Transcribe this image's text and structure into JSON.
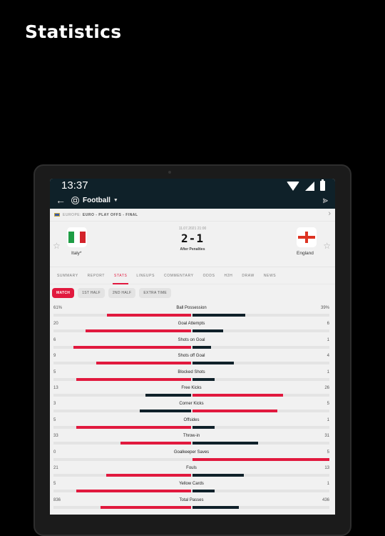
{
  "page_title": "Statistics",
  "status_bar": {
    "time": "13:37"
  },
  "app_bar": {
    "sport": "Football",
    "back_icon": "arrow-left-icon",
    "share_icon": "share-icon"
  },
  "league": {
    "region": "EUROPE:",
    "competition": "EURO - PLAY OFFS - FINAL"
  },
  "match": {
    "datetime": "11.07.2021 21:00",
    "score": "2-1",
    "note": "After Penalties",
    "home": {
      "name": "Italy*",
      "flag_colors": [
        "#1f9d45",
        "#ffffff",
        "#d3222a"
      ]
    },
    "away": {
      "name": "England"
    }
  },
  "tabs": [
    {
      "label": "SUMMARY",
      "active": false
    },
    {
      "label": "REPORT",
      "active": false
    },
    {
      "label": "STATS",
      "active": true
    },
    {
      "label": "LINEUPS",
      "active": false
    },
    {
      "label": "COMMENTARY",
      "active": false
    },
    {
      "label": "ODDS",
      "active": false
    },
    {
      "label": "H2H",
      "active": false
    },
    {
      "label": "DRAW",
      "active": false
    },
    {
      "label": "NEWS",
      "active": false
    }
  ],
  "periods": [
    {
      "label": "MATCH",
      "active": true
    },
    {
      "label": "1ST HALF",
      "active": false
    },
    {
      "label": "2ND HALF",
      "active": false
    },
    {
      "label": "EXTRA TIME",
      "active": false
    }
  ],
  "colors": {
    "accent": "#e1193e",
    "dark": "#10212a"
  },
  "stats": [
    {
      "label": "Ball Possession",
      "home": "61%",
      "away": "39%",
      "hv": 61,
      "av": 39
    },
    {
      "label": "Goal Attempts",
      "home": "20",
      "away": "6",
      "hv": 20,
      "av": 6
    },
    {
      "label": "Shots on Goal",
      "home": "6",
      "away": "1",
      "hv": 6,
      "av": 1
    },
    {
      "label": "Shots off Goal",
      "home": "9",
      "away": "4",
      "hv": 9,
      "av": 4
    },
    {
      "label": "Blocked Shots",
      "home": "5",
      "away": "1",
      "hv": 5,
      "av": 1
    },
    {
      "label": "Free Kicks",
      "home": "13",
      "away": "26",
      "hv": 13,
      "av": 26
    },
    {
      "label": "Corner Kicks",
      "home": "3",
      "away": "5",
      "hv": 3,
      "av": 5
    },
    {
      "label": "Offsides",
      "home": "5",
      "away": "1",
      "hv": 5,
      "av": 1
    },
    {
      "label": "Throw-in",
      "home": "33",
      "away": "31",
      "hv": 33,
      "av": 31
    },
    {
      "label": "Goalkeeper Saves",
      "home": "0",
      "away": "5",
      "hv": 0,
      "av": 5
    },
    {
      "label": "Fouls",
      "home": "21",
      "away": "13",
      "hv": 21,
      "av": 13
    },
    {
      "label": "Yellow Cards",
      "home": "5",
      "away": "1",
      "hv": 5,
      "av": 1
    },
    {
      "label": "Total Passes",
      "home": "836",
      "away": "436",
      "hv": 836,
      "av": 436
    }
  ]
}
